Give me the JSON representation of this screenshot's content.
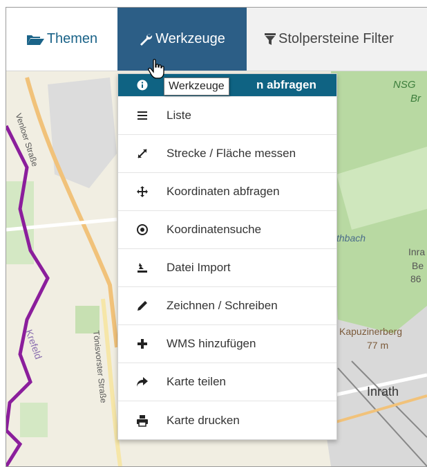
{
  "nav": {
    "themen": "Themen",
    "werkzeuge": "Werkzeuge",
    "stolpersteine": "Stolpersteine Filter"
  },
  "tooltip": "Werkzeuge",
  "menu": [
    {
      "label": "n abfragen",
      "icon": "info-icon"
    },
    {
      "label": "Liste",
      "icon": "list-icon"
    },
    {
      "label": "Strecke / Fläche messen",
      "icon": "measure-icon"
    },
    {
      "label": "Koordinaten abfragen",
      "icon": "crosshair-move-icon"
    },
    {
      "label": "Koordinatensuche",
      "icon": "target-icon"
    },
    {
      "label": "Datei Import",
      "icon": "import-icon"
    },
    {
      "label": "Zeichnen / Schreiben",
      "icon": "pencil-icon"
    },
    {
      "label": "WMS hinzufügen",
      "icon": "plus-icon"
    },
    {
      "label": "Karte teilen",
      "icon": "share-icon"
    },
    {
      "label": "Karte drucken",
      "icon": "print-icon"
    }
  ],
  "map_labels": {
    "venloer": "Venloer Straße",
    "nsg": "NSG",
    "br": "Br",
    "thbach": "thbach",
    "ink": "Inra",
    "be": "Be",
    "num86": "86",
    "kapuzinerberg": "Kapuzinerberg",
    "height": "77 m",
    "krefeld": "Krefeld",
    "toenisvorster": "Tönisvorster Straße",
    "inrath": "Inrath"
  },
  "colors": {
    "nav_active": "#2c5e86",
    "menu_active": "#0f6383",
    "boundary": "#8b1e9c",
    "forest": "#b6d7a0"
  }
}
